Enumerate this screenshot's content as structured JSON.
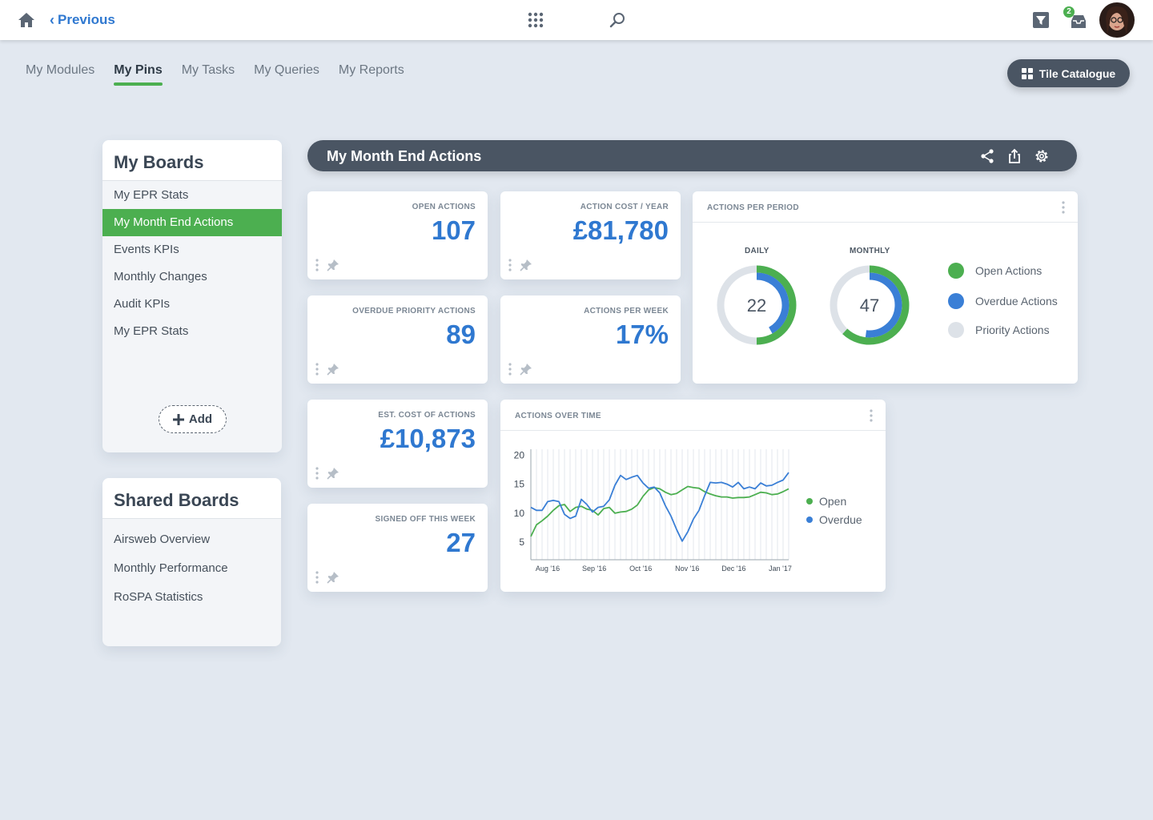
{
  "topbar": {
    "previous_label": "Previous",
    "inbox_badge": "2"
  },
  "tabs": [
    {
      "label": "My Modules",
      "active": false
    },
    {
      "label": "My Pins",
      "active": true
    },
    {
      "label": "My Tasks",
      "active": false
    },
    {
      "label": "My Queries",
      "active": false
    },
    {
      "label": "My Reports",
      "active": false
    }
  ],
  "tile_catalogue_label": "Tile Catalogue",
  "my_boards": {
    "title": "My Boards",
    "items": [
      "My EPR Stats",
      "My Month End Actions",
      "Events KPIs",
      "Monthly Changes",
      "Audit KPIs",
      "My EPR Stats"
    ],
    "selected_index": 1,
    "add_label": "Add"
  },
  "shared_boards": {
    "title": "Shared Boards",
    "items": [
      "Airsweb Overview",
      "Monthly Performance",
      "RoSPA Statistics"
    ]
  },
  "board": {
    "title": "My Month End Actions"
  },
  "tiles": [
    {
      "label": "OPEN ACTIONS",
      "value": "107"
    },
    {
      "label": "ACTION COST / YEAR",
      "value": "£81,780"
    },
    {
      "label": "OVERDUE PRIORITY ACTIONS",
      "value": "89"
    },
    {
      "label": "ACTIONS PER WEEK",
      "value": "17%"
    },
    {
      "label": "EST. COST OF ACTIONS",
      "value": "£10,873"
    },
    {
      "label": "SIGNED OFF THIS WEEK",
      "value": "27"
    }
  ],
  "period_widget": {
    "title": "ACTIONS PER PERIOD",
    "daily_label": "DAILY",
    "daily_value": "22",
    "monthly_label": "MONTHLY",
    "monthly_value": "47",
    "legend": [
      "Open Actions",
      "Overdue Actions",
      "Priority Actions"
    ],
    "colors": {
      "open": "#4caf50",
      "overdue": "#3a7fd6",
      "priority": "#dde2e8"
    },
    "daily_open_fraction": 0.5,
    "daily_overdue_fraction": 0.42,
    "monthly_open_fraction": 0.62,
    "monthly_overdue_fraction": 0.52
  },
  "chart_widget": {
    "title": "ACTIONS OVER TIME"
  },
  "chart_data": {
    "type": "line",
    "title": "",
    "xlabel": "",
    "ylabel": "",
    "x_tick_labels": [
      "Aug '16",
      "Sep '16",
      "Oct '16",
      "Nov '16",
      "Dec '16",
      "Jan '17"
    ],
    "y_ticks": [
      5,
      10,
      15,
      20
    ],
    "ylim": [
      2,
      21
    ],
    "grid": "vertical",
    "legend_position": "right",
    "series": [
      {
        "name": "Open",
        "color": "#4caf50",
        "values": [
          6,
          8,
          8.7,
          9.5,
          10.5,
          11.3,
          11.5,
          10.3,
          11,
          11.2,
          10.7,
          10.5,
          9.7,
          10.8,
          11,
          10,
          10.2,
          10.3,
          10.7,
          11.4,
          12.9,
          14,
          14.4,
          14.2,
          13.6,
          13.2,
          13.4,
          14,
          14.6,
          14.4,
          14.3,
          13.7,
          13.3,
          13,
          12.8,
          12.8,
          12.6,
          12.7,
          12.7,
          12.8,
          13.2,
          13.6,
          13.5,
          13.2,
          13.3,
          13.7,
          14.2
        ]
      },
      {
        "name": "Overdue",
        "color": "#3a7fd6",
        "values": [
          11,
          10.5,
          10.5,
          12,
          12.2,
          12,
          9.8,
          9.1,
          9.5,
          12.4,
          11.5,
          10.2,
          11,
          11.2,
          12.3,
          14.8,
          16.5,
          15.8,
          16.2,
          16.5,
          15.2,
          14.3,
          14.5,
          13.5,
          11.3,
          9.5,
          7.2,
          5.2,
          6.8,
          9,
          10.5,
          13,
          15.3,
          15.2,
          15.3,
          15,
          14.5,
          15.3,
          14.2,
          14.5,
          14.2,
          15.2,
          14.7,
          14.8,
          15.3,
          15.7,
          17
        ]
      }
    ]
  }
}
